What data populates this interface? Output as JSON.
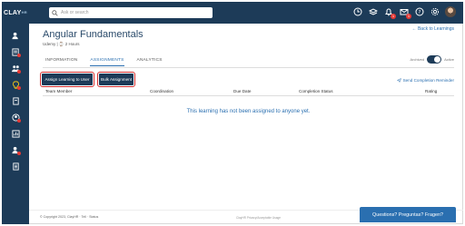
{
  "app": {
    "logo_text": "CLAY",
    "logo_sub": "HR"
  },
  "search": {
    "placeholder": "Ask or search"
  },
  "topbar": {
    "icons": [
      "clock-icon",
      "layers-icon",
      "bell-icon",
      "mail-icon",
      "help-icon",
      "settings-icon"
    ],
    "bell_badge": "1",
    "mail_badge": "1"
  },
  "sidebar": {
    "items": [
      "users-icon",
      "user-plus-icon",
      "team-icon",
      "learning-icon",
      "documents-icon",
      "profile-icon",
      "reports-icon",
      "team-alert-icon",
      "list-icon"
    ]
  },
  "page": {
    "title": "Angular Fundamentals",
    "meta": "Udemy | ⌚ 2 Hours",
    "back_link": "← Back to Learnings"
  },
  "tabs": [
    {
      "label": "INFORMATION"
    },
    {
      "label": "ASSIGNMENTS"
    },
    {
      "label": "ANALYTICS"
    }
  ],
  "toggle": {
    "left_label": "Archived",
    "right_label": "Active"
  },
  "actions": {
    "assign_label": "Assign Learning to User",
    "bulk_label": "Bulk Assignment",
    "reminder_label": "Send Completion Reminder"
  },
  "table": {
    "columns": [
      "Team Member",
      "Coordination",
      "Due Date",
      "Completion Status",
      "Rating"
    ],
    "empty_message": "This learning has not been assigned to anyone yet."
  },
  "footer": {
    "copyright": "© Copyright 2023, ClayHR · Tell · Status",
    "policy": "ClayHR Privacy/Acceptable Usage"
  },
  "chat": {
    "label": "Questions? Preguntas? Fragen?"
  },
  "colors": {
    "nav": "#1d3b58",
    "accent": "#2a6fb0",
    "highlight": "#d32f2f"
  }
}
